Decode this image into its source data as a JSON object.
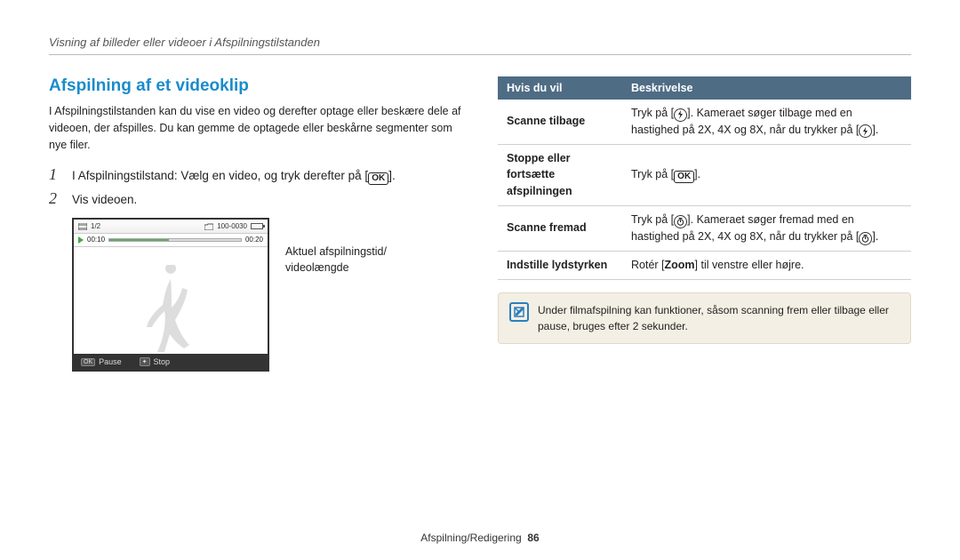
{
  "breadcrumb": "Visning af billeder eller videoer i Afspilningstilstanden",
  "section_title": "Afspilning af et videoklip",
  "intro": "I Afspilningstilstanden kan du vise en video og derefter optage eller beskære dele af videoen, der afspilles. Du kan gemme de optagede eller beskårne segmenter som nye filer.",
  "steps": [
    {
      "num": "1",
      "pre": "I Afspilningstilstand: Vælg en video, og tryk derefter på [",
      "post": "]."
    },
    {
      "num": "2",
      "pre": "Vis videoen.",
      "post": ""
    }
  ],
  "screen": {
    "counter": "1/2",
    "battery_text": "100-0030",
    "time_left": "00:10",
    "time_right": "00:20",
    "pause_label": "Pause",
    "stop_label": "Stop",
    "ok": "OK"
  },
  "caption_l1": "Aktuel afspilningstid/",
  "caption_l2": "videolængde",
  "table": {
    "h1": "Hvis du vil",
    "h2": "Beskrivelse",
    "rows": [
      {
        "k": "Scanne tilbage",
        "v_pre": "Tryk på [",
        "v_mid": "]. Kameraet søger tilbage med en hastighed på 2X, 4X og 8X, når du trykker på [",
        "v_post": "].",
        "icon": "back"
      },
      {
        "k": "Stoppe eller fortsætte afspilningen",
        "v_pre": "Tryk på [",
        "v_mid": "",
        "v_post": "].",
        "icon": "ok"
      },
      {
        "k": "Scanne fremad",
        "v_pre": "Tryk på [",
        "v_mid": "]. Kameraet søger fremad med en hastighed på 2X, 4X og 8X, når du trykker på [",
        "v_post": "].",
        "icon": "fwd"
      },
      {
        "k": "Indstille lydstyrken",
        "v_plain": "Rotér [Zoom] til venstre eller højre.",
        "bold": "Zoom"
      }
    ]
  },
  "note_text": "Under filmafspilning kan funktioner, såsom scanning frem eller tilbage eller pause, bruges efter 2 sekunder.",
  "footer_section": "Afspilning/Redigering",
  "footer_page": "86"
}
